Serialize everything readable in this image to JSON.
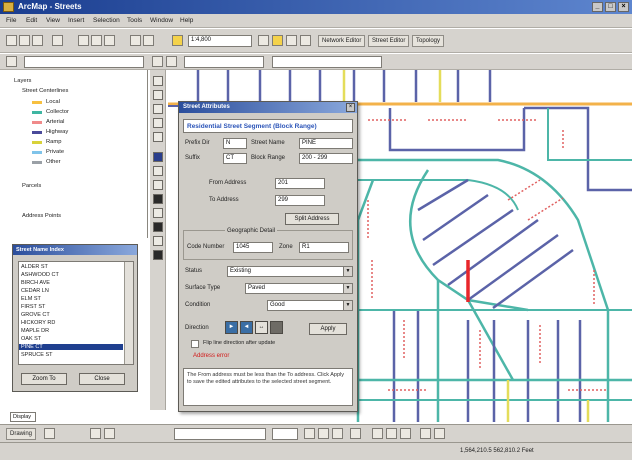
{
  "window": {
    "title": "ArcMap - Streets"
  },
  "menu": [
    "File",
    "Edit",
    "View",
    "Insert",
    "Selection",
    "Tools",
    "Window",
    "Help"
  ],
  "toolbar": {
    "scale_value": "1:4,800",
    "buttons": [
      "Network Editor",
      "Street Editor",
      "Topology"
    ]
  },
  "toc": {
    "layers_label": "Layers",
    "streets_label": "Street Centerlines",
    "legend": [
      {
        "label": "Local",
        "color": "#f7c040"
      },
      {
        "label": "Collector",
        "color": "#3fb6a2"
      },
      {
        "label": "Arterial",
        "color": "#f08a8a"
      },
      {
        "label": "Highway",
        "color": "#4a4a9a"
      },
      {
        "label": "Ramp",
        "color": "#d8d23a"
      },
      {
        "label": "Private",
        "color": "#7fc4ea"
      },
      {
        "label": "Other",
        "color": "#9aa0a6"
      }
    ],
    "parcels_label": "Parcels",
    "address_points_label": "Address Points"
  },
  "listpanel": {
    "title": "Street Name Index",
    "rows": [
      "ALDER ST",
      "ASHWOOD CT",
      "BIRCH AVE",
      "CEDAR LN",
      "ELM ST",
      "FIRST ST",
      "GROVE CT",
      "HICKORY RD",
      "MAPLE DR",
      "OAK ST",
      "PINE CT",
      "SPRUCE ST"
    ],
    "selected_row": "PINE CT",
    "find_label": "Zoom To",
    "close_label": "Close"
  },
  "dialog": {
    "title": "Street Attributes",
    "header": "Residential Street Segment (Block Range)",
    "fields": [
      {
        "label": "Prefix Dir",
        "value": "N"
      },
      {
        "label": "Street Name",
        "value": "PINE"
      },
      {
        "label": "Suffix",
        "value": "CT"
      },
      {
        "label": "Block Range",
        "value": "200 - 299"
      },
      {
        "label": "From Address",
        "value": "201"
      },
      {
        "label": "To Address",
        "value": "299"
      }
    ],
    "split_label": "Split Address",
    "group_label": "Geographic Detail",
    "code_label": "Code Number",
    "code_value": "1045",
    "zone_label": "Zone",
    "zone_value": "R1",
    "dropdowns": [
      {
        "label": "Status",
        "value": "Existing"
      },
      {
        "label": "Surface Type",
        "value": "Paved"
      },
      {
        "label": "Condition",
        "value": "Good"
      }
    ],
    "direction_label": "Direction",
    "apply_label": "Apply",
    "checkbox_label": "Flip line direction after update",
    "error_text": "Address error",
    "status_text": "The From address must be less than the To address. Click Apply to save the edited attributes to the selected street segment."
  },
  "bottom": {
    "tab_label": "Display",
    "drawing_label": "Drawing"
  },
  "status": {
    "coords": "1,564,210.5  562,810.2 Feet"
  },
  "map": {
    "colors": {
      "street_blue": "#5b63a8",
      "street_teal": "#4db6a8",
      "street_orange": "#f3b24a",
      "street_yellow": "#e4dd5a",
      "street_red_label": "#e06060",
      "selected": "#e8262a"
    }
  }
}
